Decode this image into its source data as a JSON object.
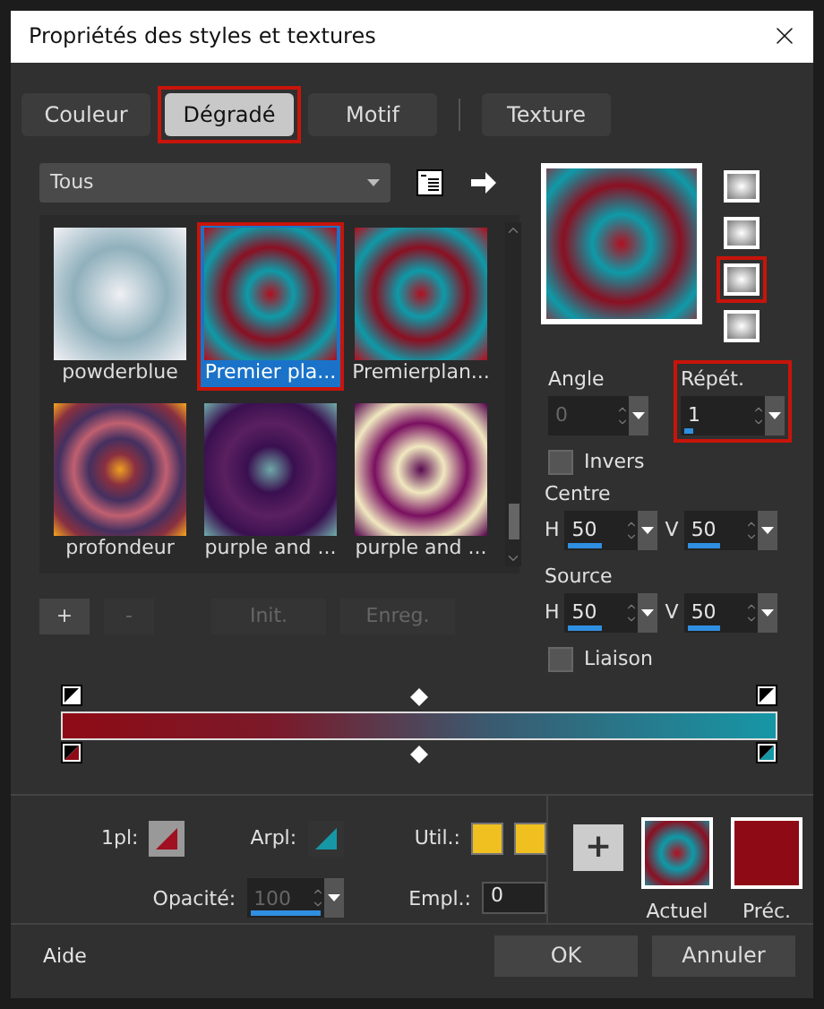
{
  "window": {
    "title": "Propriétés des styles et textures"
  },
  "tabs": [
    {
      "label": "Couleur",
      "selected": false,
      "highlighted": false
    },
    {
      "label": "Dégradé",
      "selected": true,
      "highlighted": true
    },
    {
      "label": "Motif",
      "selected": false,
      "highlighted": false
    },
    {
      "label": "Texture",
      "selected": false,
      "highlighted": false
    }
  ],
  "library": {
    "filter": "Tous",
    "items": [
      {
        "label": "powderblue",
        "selected": false,
        "highlighted": false
      },
      {
        "label": "Premier pla...",
        "selected": true,
        "highlighted": true
      },
      {
        "label": "Premierplan...",
        "selected": false,
        "highlighted": false
      },
      {
        "label": "profondeur",
        "selected": false,
        "highlighted": false
      },
      {
        "label": "purple and ...",
        "selected": false,
        "highlighted": false
      },
      {
        "label": "purple and ...",
        "selected": false,
        "highlighted": false
      }
    ],
    "buttons": [
      {
        "label": "+",
        "disabled": false
      },
      {
        "label": "-",
        "disabled": true
      },
      {
        "label": "Init.",
        "disabled": true
      },
      {
        "label": "Enreg.",
        "disabled": true
      }
    ]
  },
  "style": {
    "shapes": [
      {
        "highlighted": false
      },
      {
        "highlighted": false
      },
      {
        "highlighted": true
      },
      {
        "highlighted": false
      }
    ],
    "angle": {
      "label": "Angle",
      "value": "0",
      "disabled": true
    },
    "repeat": {
      "label": "Répét.",
      "value": "1",
      "disabled": false,
      "highlighted": true
    },
    "invert": {
      "label": "Invers",
      "checked": false
    },
    "centre": {
      "label": "Centre",
      "fields": [
        {
          "axis": "H",
          "value": "50"
        },
        {
          "axis": "V",
          "value": "50"
        }
      ]
    },
    "source": {
      "label": "Source",
      "fields": [
        {
          "axis": "H",
          "value": "50"
        },
        {
          "axis": "V",
          "value": "50"
        }
      ]
    },
    "link": {
      "label": "Liaison",
      "checked": false
    }
  },
  "stop": {
    "foreground": "1pl:",
    "background": "Arpl:",
    "user": "Util.:",
    "opacity": {
      "label": "Opacité:",
      "value": "100",
      "disabled": true
    },
    "location": {
      "label": "Empl.:",
      "value": "0"
    }
  },
  "compare": {
    "add": "+",
    "current": "Actuel",
    "previous": "Préc."
  },
  "footer": {
    "help": "Aide",
    "buttons": [
      "OK",
      "Annuler"
    ]
  }
}
